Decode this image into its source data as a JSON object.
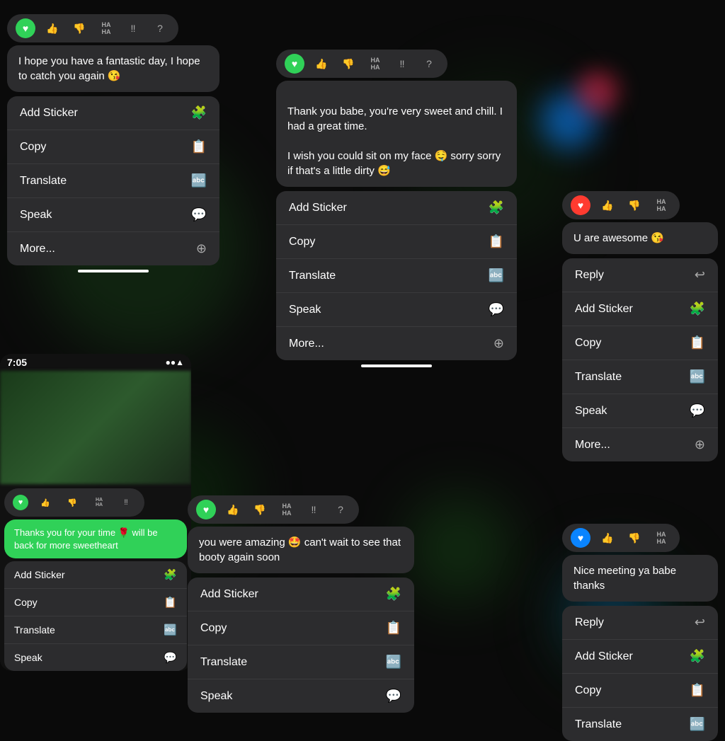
{
  "panel1": {
    "message": "I hope you have a fantastic day, I hope to catch you again 😘",
    "reaction_bar": {
      "heart": "♥",
      "thumbsup": "👍",
      "thumbsdown": "👎",
      "haha": "HA HA",
      "exclaim": "‼",
      "question": "?"
    },
    "menu": [
      {
        "label": "Add Sticker",
        "icon": "🪧"
      },
      {
        "label": "Copy",
        "icon": "📋"
      },
      {
        "label": "Translate",
        "icon": "🔤"
      },
      {
        "label": "Speak",
        "icon": "💬"
      },
      {
        "label": "More...",
        "icon": "⊕"
      }
    ]
  },
  "panel2": {
    "message": "Thank you babe, you're very sweet and chill. I had a great time.\n\nI wish you could sit on my face 🤤 sorry sorry if that's a little dirty 😅",
    "menu": [
      {
        "label": "Add Sticker",
        "icon": "🪧"
      },
      {
        "label": "Copy",
        "icon": "📋"
      },
      {
        "label": "Translate",
        "icon": "🔤"
      },
      {
        "label": "Speak",
        "icon": "💬"
      },
      {
        "label": "More...",
        "icon": "⊕"
      }
    ]
  },
  "panel3": {
    "message": "U are awesome 😘",
    "menu": [
      {
        "label": "Reply",
        "icon": "↩"
      },
      {
        "label": "Add Sticker",
        "icon": "🪧"
      },
      {
        "label": "Copy",
        "icon": "📋"
      },
      {
        "label": "Translate",
        "icon": "🔤"
      },
      {
        "label": "Speak",
        "icon": "💬"
      },
      {
        "label": "More...",
        "icon": "⊕"
      }
    ]
  },
  "panel4": {
    "time": "7:05",
    "message": "Thanks you for your time 🌹 will be back for more sweetheart",
    "menu": [
      {
        "label": "Add Sticker",
        "icon": "🪧"
      },
      {
        "label": "Copy",
        "icon": "📋"
      },
      {
        "label": "Translate",
        "icon": "🔤"
      },
      {
        "label": "Speak",
        "icon": "💬"
      }
    ]
  },
  "panel5": {
    "message": "you were amazing 🤩 can't wait to see that booty again soon",
    "menu": [
      {
        "label": "Add Sticker",
        "icon": "🪧"
      },
      {
        "label": "Copy",
        "icon": "📋"
      },
      {
        "label": "Translate",
        "icon": "🔤"
      },
      {
        "label": "Speak",
        "icon": "💬"
      }
    ]
  },
  "panel6": {
    "message": "Nice meeting ya babe thanks",
    "menu": [
      {
        "label": "Reply",
        "icon": "↩"
      },
      {
        "label": "Add Sticker",
        "icon": "🪧"
      },
      {
        "label": "Copy",
        "icon": "📋"
      },
      {
        "label": "Translate",
        "icon": "🔤"
      }
    ]
  }
}
